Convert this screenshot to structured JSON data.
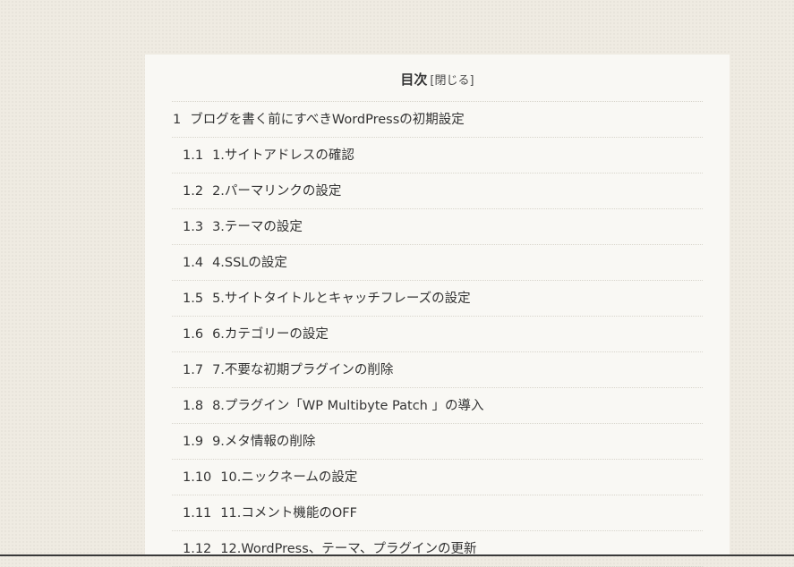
{
  "toc": {
    "title": "目次",
    "toggle_label": "[閉じる]",
    "items": [
      {
        "num": "1",
        "label": "ブログを書く前にすべきWordPressの初期設定",
        "level": 1
      },
      {
        "num": "1.1",
        "label": "1.サイトアドレスの確認",
        "level": 2
      },
      {
        "num": "1.2",
        "label": "2.パーマリンクの設定",
        "level": 2
      },
      {
        "num": "1.3",
        "label": "3.テーマの設定",
        "level": 2
      },
      {
        "num": "1.4",
        "label": "4.SSLの設定",
        "level": 2
      },
      {
        "num": "1.5",
        "label": "5.サイトタイトルとキャッチフレーズの設定",
        "level": 2
      },
      {
        "num": "1.6",
        "label": "6.カテゴリーの設定",
        "level": 2
      },
      {
        "num": "1.7",
        "label": "7.不要な初期プラグインの削除",
        "level": 2
      },
      {
        "num": "1.8",
        "label": "8.プラグイン「WP Multibyte Patch 」の導入",
        "level": 2
      },
      {
        "num": "1.9",
        "label": "9.メタ情報の削除",
        "level": 2
      },
      {
        "num": "1.10",
        "label": "10.ニックネームの設定",
        "level": 2
      },
      {
        "num": "1.11",
        "label": "11.コメント機能のOFF",
        "level": 2
      },
      {
        "num": "1.12",
        "label": "12.WordPress、テーマ、プラグインの更新",
        "level": 2
      }
    ]
  },
  "colors": {
    "page_background": "#efebe2",
    "panel_background": "#f9f8f4",
    "text": "#333333",
    "divider": "#d8d5cc"
  }
}
